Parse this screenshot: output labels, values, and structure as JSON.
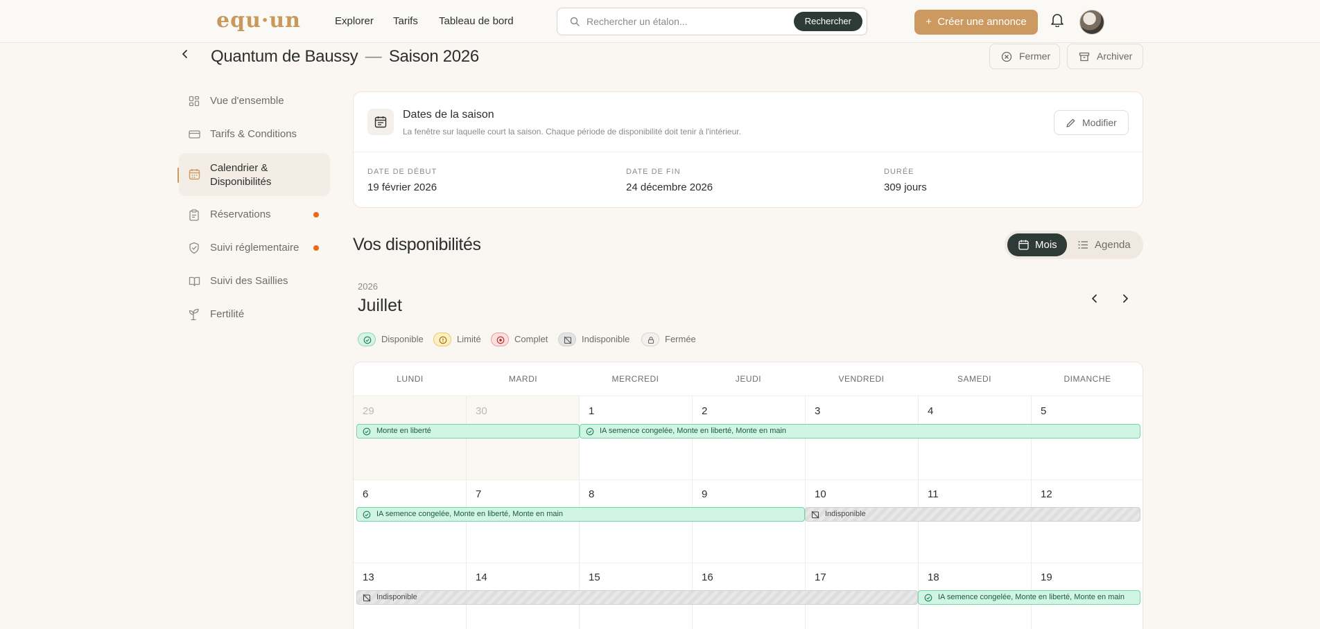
{
  "header": {
    "logo": "equ·un",
    "nav": [
      "Explorer",
      "Tarifs",
      "Tableau de bord"
    ],
    "search": {
      "placeholder": "Rechercher un étalon...",
      "button": "Rechercher"
    },
    "create_button": "Créer une annonce"
  },
  "page": {
    "title_horse": "Quantum de Baussy",
    "title_sep": "—",
    "title_season": "Saison 2026",
    "close_label": "Fermer",
    "archive_label": "Archiver"
  },
  "sidebar": {
    "items": [
      {
        "label": "Vue d'ensemble"
      },
      {
        "label": "Tarifs & Conditions"
      },
      {
        "label": "Calendrier & Disponibilités",
        "active": true
      },
      {
        "label": "Réservations",
        "badge": true
      },
      {
        "label": "Suivi réglementaire",
        "badge": true
      },
      {
        "label": "Suivi des Saillies"
      },
      {
        "label": "Fertilité"
      }
    ]
  },
  "season_card": {
    "title": "Dates de la saison",
    "description": "La fenêtre sur laquelle court la saison. Chaque période de disponibilité doit tenir à l'intérieur.",
    "modify_label": "Modifier",
    "start_label": "DATE DE DÉBUT",
    "start_value": "19 février 2026",
    "end_label": "DATE DE FIN",
    "end_value": "24 décembre 2026",
    "duration_label": "DURÉE",
    "duration_value": "309 jours"
  },
  "availability": {
    "title": "Vos disponibilités",
    "view_month": "Mois",
    "view_agenda": "Agenda"
  },
  "calendar": {
    "year": "2026",
    "month": "Juillet",
    "legend": [
      "Disponible",
      "Limité",
      "Complet",
      "Indisponible",
      "Fermée"
    ],
    "weekdays": [
      "LUNDI",
      "MARDI",
      "MERCREDI",
      "JEUDI",
      "VENDREDI",
      "SAMEDI",
      "DIMANCHE"
    ],
    "weeks": [
      [
        "29",
        "30",
        "1",
        "2",
        "3",
        "4",
        "5"
      ],
      [
        "6",
        "7",
        "8",
        "9",
        "10",
        "11",
        "12"
      ],
      [
        "13",
        "14",
        "15",
        "16",
        "17",
        "18",
        "19"
      ]
    ],
    "events": {
      "w1a": "Monte en liberté",
      "w1b": "IA semence congelée, Monte en liberté, Monte en main",
      "w2a": "IA semence congelée, Monte en liberté, Monte en main",
      "w2b": "Indisponible",
      "w3a": "Indisponible",
      "w3b": "IA semence congelée, Monte en liberté, Monte en main"
    }
  },
  "colors": {
    "accent": "#cc9a61",
    "dark": "#2e3a36",
    "available_bg": "#d1f5e4",
    "available_border": "#74d4a4",
    "badge": "#e86b1c"
  }
}
